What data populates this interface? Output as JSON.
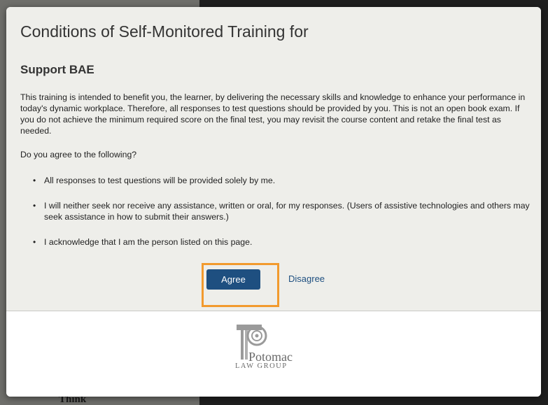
{
  "dialog": {
    "title": "Conditions of Self-Monitored Training for",
    "subtitle": "Support BAE",
    "intro": "This training is intended to benefit you, the learner, by delivering the necessary skills and knowledge to enhance your performance in today's dynamic workplace. Therefore, all responses to test questions should be provided by you. This is not an open book exam. If you do not achieve the minimum required score on the final test, you may revisit the course content and retake the final test as needed.",
    "question": "Do you agree to the following?",
    "conditions": [
      "All responses to test questions will be provided solely by me.",
      "I will neither seek nor receive any assistance, written or oral, for my responses. (Users of assistive technologies and others may seek assistance in how to submit their answers.)",
      "I acknowledge that I am the person listed on this page."
    ],
    "agree_label": "Agree",
    "disagree_label": "Disagree"
  },
  "footer": {
    "logo_name": "Potomac",
    "logo_sub": "LAW GROUP"
  },
  "background": {
    "bottom_text": "Think"
  },
  "colors": {
    "accent": "#1e4f80",
    "highlight": "#f29a2e",
    "dialog_bg": "#eeeeea"
  }
}
